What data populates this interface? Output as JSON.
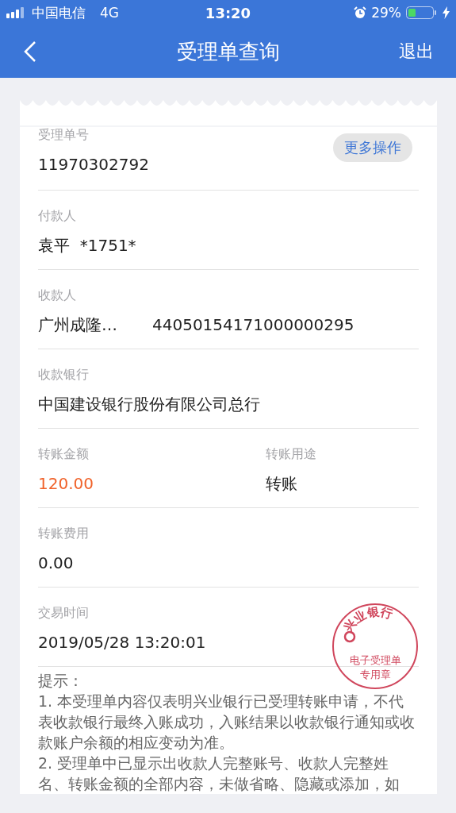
{
  "status_bar": {
    "carrier": "中国电信",
    "network": "4G",
    "time": "13:20",
    "battery": "29%"
  },
  "nav": {
    "title": "受理单查询",
    "action": "退出"
  },
  "receipt": {
    "more_button": "更多操作",
    "rows": [
      {
        "fields": [
          {
            "label": "受理单号",
            "value": "11970302792",
            "kind": "plain"
          }
        ]
      },
      {
        "fields": [
          {
            "label": "付款人",
            "value": "袁平  *1751*",
            "kind": "plain"
          }
        ]
      },
      {
        "fields": [
          {
            "label": "收款人",
            "value": "广州成隆…",
            "account": "44050154171000000295",
            "kind": "plain"
          }
        ]
      },
      {
        "fields": [
          {
            "label": "收款银行",
            "value": "中国建设银行股份有限公司总行",
            "kind": "plain"
          }
        ]
      },
      {
        "fields": [
          {
            "label": "转账金额",
            "value": "120.00",
            "kind": "amount"
          },
          {
            "label": "转账用途",
            "value": "转账",
            "kind": "plain"
          }
        ]
      },
      {
        "fields": [
          {
            "label": "转账费用",
            "value": "0.00",
            "kind": "plain"
          }
        ]
      },
      {
        "fields": [
          {
            "label": "交易时间",
            "value": "2019/05/28 13:20:01",
            "kind": "plain"
          }
        ]
      }
    ],
    "stamp": {
      "bank": "兴业银行",
      "line1": "电子受理单",
      "line2": "专用章"
    },
    "notes": {
      "title": "提示：",
      "items": [
        "1. 本受理单内容仅表明兴业银行已受理转账申请，不代表收款银行最终入账成功，入账结果以收款银行通知或收款账户余额的相应变动为准。",
        "2. 受理单中已显示出收款人完整账号、收款人完整姓名、转账金额的全部内容，未做省略、隐藏或添加，如"
      ]
    }
  }
}
